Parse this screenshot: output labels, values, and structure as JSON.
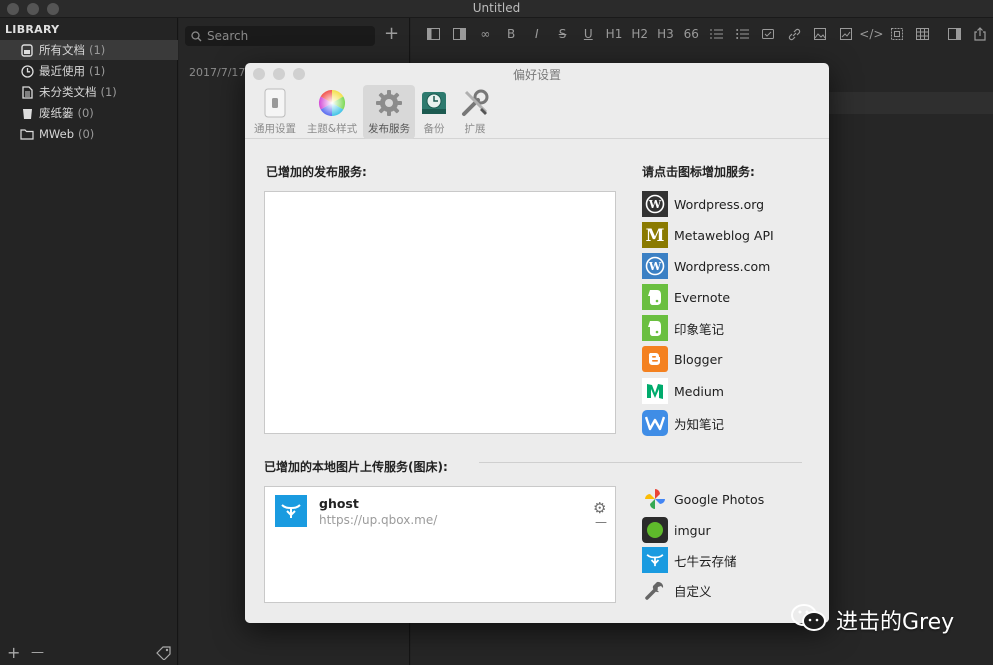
{
  "window": {
    "title": "Untitled"
  },
  "sidebar": {
    "header": "LIBRARY",
    "items": [
      {
        "label": "所有文档",
        "count": "(1)",
        "icon": "all-docs-icon"
      },
      {
        "label": "最近使用",
        "count": "(1)",
        "icon": "clock-icon"
      },
      {
        "label": "未分类文档",
        "count": "(1)",
        "icon": "document-icon"
      },
      {
        "label": "废纸篓",
        "count": "(0)",
        "icon": "trash-icon"
      },
      {
        "label": "MWeb",
        "count": "(0)",
        "icon": "folder-icon"
      }
    ],
    "bottom": {
      "add": "+",
      "remove": "—"
    }
  },
  "doclist": {
    "search_placeholder": "Search",
    "add": "+",
    "date": "2017/7/17"
  },
  "toolbar": {
    "buttons": [
      "B",
      "I",
      "S",
      "U",
      "H1",
      "H2",
      "H3",
      "66"
    ]
  },
  "prefs": {
    "title": "偏好设置",
    "tabs": [
      {
        "label": "通用设置"
      },
      {
        "label": "主题&样式"
      },
      {
        "label": "发布服务"
      },
      {
        "label": "备份"
      },
      {
        "label": "扩展"
      }
    ],
    "publish_section_title": "已增加的发布服务:",
    "add_service_title": "请点击图标增加服务:",
    "services": [
      {
        "name": "Wordpress.org",
        "icon": "wordpress-org-icon",
        "color": "#333333"
      },
      {
        "name": "Metaweblog API",
        "icon": "metaweblog-icon",
        "color": "#8a7a00"
      },
      {
        "name": "Wordpress.com",
        "icon": "wordpress-com-icon",
        "color": "#3b80c4"
      },
      {
        "name": "Evernote",
        "icon": "evernote-icon",
        "color": "#6abf40"
      },
      {
        "name": "印象笔记",
        "icon": "yinxiang-icon",
        "color": "#6abf40"
      },
      {
        "name": "Blogger",
        "icon": "blogger-icon",
        "color": "#f48120"
      },
      {
        "name": "Medium",
        "icon": "medium-icon",
        "color": "#00ab6c"
      },
      {
        "name": "为知笔记",
        "icon": "wiz-icon",
        "color": "#3f8de6"
      }
    ],
    "image_section_title": "已增加的本地图片上传服务(图床):",
    "image_services_added": [
      {
        "name": "ghost",
        "url": "https://up.qbox.me/"
      }
    ],
    "image_services": [
      {
        "name": "Google Photos",
        "icon": "google-photos-icon"
      },
      {
        "name": "imgur",
        "icon": "imgur-icon"
      },
      {
        "name": "七牛云存储",
        "icon": "qiniu-icon"
      },
      {
        "name": "自定义",
        "icon": "wrench-icon"
      }
    ]
  },
  "watermark": {
    "text": "进击的Grey"
  }
}
